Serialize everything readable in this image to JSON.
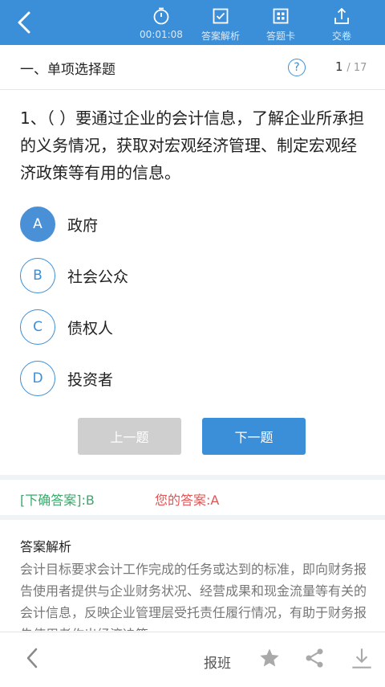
{
  "toolbar": {
    "timer": "00:01:08",
    "analysis": "答案解析",
    "answer_card": "答题卡",
    "submit": "交卷"
  },
  "section": {
    "title": "一、单项选择题",
    "help": "?",
    "current": "1",
    "total": "/ 17"
  },
  "question": {
    "text": "1、（ ）要通过企业的会计信息，了解企业所承担的义务情况，获取对宏观经济管理、制定宏观经济政策等有用的信息。",
    "options": [
      {
        "letter": "A",
        "text": "政府"
      },
      {
        "letter": "B",
        "text": "社会公众"
      },
      {
        "letter": "C",
        "text": "债权人"
      },
      {
        "letter": "D",
        "text": "投资者"
      }
    ]
  },
  "nav": {
    "prev": "上一题",
    "next": "下一题"
  },
  "result": {
    "correct": "[下确答案]:B",
    "yours": "您的答案:A"
  },
  "analysis": {
    "title": "答案解析",
    "body": "会计目标要求会计工作完成的任务或达到的标准，即向财务报告使用者提供与企业财务状况、经营成果和现金流量等有关的会计信息，反映企业管理层受托责任履行情况，有助于财务报告使用者作出经济决策。"
  },
  "bottom": {
    "report": "报班"
  },
  "colors": {
    "brand": "#3b8fd9",
    "correct": "#3aaa6b",
    "wrong": "#e25454"
  }
}
